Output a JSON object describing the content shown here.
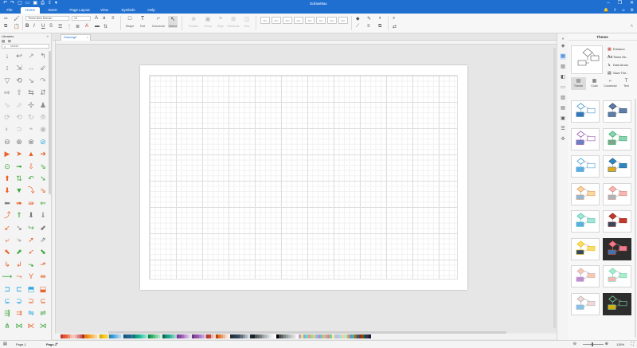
{
  "titlebar": {
    "title": "EdrawMax",
    "quick_access": [
      "undo-icon",
      "redo-icon",
      "new-file-icon",
      "open-icon",
      "save-icon",
      "print-icon",
      "export-icon",
      "more-icon"
    ],
    "window_buttons": [
      "minimize-icon",
      "maximize-icon",
      "close-icon"
    ]
  },
  "menu": {
    "tabs": [
      "File",
      "Home",
      "Insert",
      "Page Layout",
      "View",
      "Symbols",
      "Help"
    ],
    "active": "Home"
  },
  "ribbon": {
    "font_name": "Times New Roman",
    "font_size": "12",
    "tools": [
      {
        "id": "shape",
        "label": "Shape",
        "icon": "□"
      },
      {
        "id": "text",
        "label": "Text",
        "icon": "T"
      },
      {
        "id": "connector",
        "label": "Connector",
        "icon": "⌐"
      },
      {
        "id": "select",
        "label": "Select",
        "icon": "↖"
      }
    ],
    "dim_tools": [
      {
        "id": "position",
        "label": "Position",
        "icon": "⊕"
      },
      {
        "id": "group",
        "label": "Group",
        "icon": "▣"
      },
      {
        "id": "align",
        "label": "Align",
        "icon": "≡"
      },
      {
        "id": "distribute",
        "label": "Distribute",
        "icon": "⊞"
      },
      {
        "id": "size",
        "label": "Size",
        "icon": "◫"
      }
    ],
    "style_boxes": [
      "Abc",
      "Abc",
      "Abc",
      "Abc",
      "Abc",
      "Abc",
      "Abc",
      "Abc"
    ]
  },
  "library": {
    "title": "Libraries",
    "search_placeholder": "search"
  },
  "document": {
    "tab_name": "Drawing3",
    "close_glyph": "×"
  },
  "palette": {
    "colors": [
      "#c0392b",
      "#e74c3c",
      "#e8623c",
      "#f08a5d",
      "#f5b7b1",
      "#f9c9c0",
      "#e6b0aa",
      "#d98880",
      "#cd6155",
      "#a93226",
      "#e67e22",
      "#f39c12",
      "#f5b041",
      "#f8c471",
      "#fad7a0",
      "#fdebd0",
      "#d4ac0d",
      "#f1c40f",
      "#f4d03f",
      "#f7dc6f",
      "#2e86c1",
      "#3498db",
      "#5dade2",
      "#85c1e9",
      "#aed6f1",
      "#d6eaf8",
      "#1a5276",
      "#1f618d",
      "#21618c",
      "#2874a6",
      "#117a65",
      "#16a085",
      "#1abc9c",
      "#48c9b0",
      "#76d7c4",
      "#a3e4d7",
      "#1e8449",
      "#27ae60",
      "#52be80",
      "#7dcea0",
      "#a9dfbf",
      "#d4efdf",
      "#0e6655",
      "#138d75",
      "#17a589",
      "#45b39d",
      "#73c6b6",
      "#a2d9ce",
      "#7d3c98",
      "#8e44ad",
      "#a569bd",
      "#bb8fce",
      "#d2b4de",
      "#e8daef",
      "#6c3483",
      "#884ea0",
      "#9b59b6",
      "#af7ac5",
      "#c39bd3",
      "#d7bde2",
      "#b03a2e",
      "#cb4335",
      "#e6b0aa",
      "#f2d7d5",
      "#ba4a00",
      "#dc7633",
      "#e59866",
      "#edbb99",
      "#f6ddcc",
      "#fbeee6",
      "#212f3d",
      "#283747",
      "#2e4053",
      "#34495e",
      "#5d6d7e",
      "#85929e",
      "#aeb6bf",
      "#d5d8dc",
      "#1b2631",
      "#17202a",
      "#4d5656",
      "#616a6b",
      "#7b7d7d",
      "#95a5a6",
      "#b2babb",
      "#cacfd2",
      "#e5e7e9",
      "#f2f3f4",
      "#ffffff",
      "#000000",
      "#424949",
      "#626567",
      "#7f8c8d",
      "#99a3a4",
      "#b3b6b7",
      "#ccd1d1",
      "#e5e8e8",
      "#f8f9f9",
      "#c39bd3",
      "#f7dc6f",
      "#7fb3d5",
      "#76d7c4",
      "#f1948a",
      "#82e0aa",
      "#f8c471",
      "#85c1e9",
      "#bb8fce",
      "#73c6b6",
      "#f0b27a",
      "#aab7b8",
      "#d98880",
      "#7dcea0",
      "#f9e79f",
      "#a9cce3",
      "#d2b4de",
      "#a3e4d7",
      "#f5cba7",
      "#abebc6",
      "#e59866",
      "#5499c7",
      "#45b39d",
      "#af601a",
      "#1f618d",
      "#922b21",
      "#7e5109",
      "#0b5345",
      "#4a235a",
      "#17202a"
    ]
  },
  "status": {
    "page_selector": "Page-1",
    "page_tab": "Page-1",
    "add_page": "+",
    "zoom": "115%",
    "fit_icon": "fit-page-icon"
  },
  "icon_strip": [
    "fill-icon",
    "theme-icon",
    "image-icon",
    "layers-icon",
    "page-icon",
    "chart-icon",
    "data-icon",
    "history-icon",
    "list-icon",
    "expand-icon"
  ],
  "theme_panel": {
    "title": "Theme",
    "actions": [
      {
        "icon": "▦",
        "label": "Ericsson"
      },
      {
        "icon": "Aa",
        "label": "Times Ne..."
      },
      {
        "icon": "↳",
        "label": "Dark Arrow"
      },
      {
        "icon": "▤",
        "label": "Save The..."
      }
    ],
    "tabs": [
      {
        "id": "theme",
        "label": "Theme",
        "icon": "▤"
      },
      {
        "id": "color",
        "label": "Color",
        "icon": "▦"
      },
      {
        "id": "connector",
        "label": "Connector",
        "icon": "⌐"
      },
      {
        "id": "text",
        "label": "Text",
        "icon": "T"
      }
    ],
    "active_tab": "theme",
    "themes": [
      {
        "accent": "#2e86c1",
        "fill": "#ffffff",
        "box": "#3a76b6",
        "dark": false
      },
      {
        "accent": "#34495e",
        "fill": "#5d7ea8",
        "box": "#5d7ea8",
        "dark": false
      },
      {
        "accent": "#8e44ad",
        "fill": "#ffffff",
        "box": "#6a7fbf",
        "dark": false
      },
      {
        "accent": "#27ae60",
        "fill": "#8fd1b4",
        "box": "#7fa58c",
        "dark": false
      },
      {
        "accent": "#3498db",
        "fill": "#ffffff",
        "box": "#5dade2",
        "dark": false
      },
      {
        "accent": "#1f618d",
        "fill": "#2e86c1",
        "box": "#e6a817",
        "dark": false
      },
      {
        "accent": "#e59866",
        "fill": "#fad7a0",
        "box": "#8fb8d8",
        "dark": false
      },
      {
        "accent": "#d98880",
        "fill": "#f5b7b1",
        "box": "#aab7b8",
        "dark": false
      },
      {
        "accent": "#48c9b0",
        "fill": "#a3e4d7",
        "box": "#5dade2",
        "dark": false
      },
      {
        "accent": "#922b21",
        "fill": "#c0392b",
        "box": "#34495e",
        "dark": false
      },
      {
        "accent": "#f1c40f",
        "fill": "#f7dc6f",
        "box": "#34495e",
        "dark": false
      },
      {
        "accent": "#e74c3c",
        "fill": "#e67e9a",
        "box": "#3a76b6",
        "dark": true
      },
      {
        "accent": "#d2b4de",
        "fill": "#f5cba7",
        "box": "#bb8fce",
        "dark": false
      },
      {
        "accent": "#76d7c4",
        "fill": "#abebc6",
        "box": "#f5b7b1",
        "dark": false
      },
      {
        "accent": "#aab7b8",
        "fill": "#f2d7d5",
        "box": "#85c1e9",
        "dark": false
      },
      {
        "accent": "#82e0aa",
        "fill": "#2d2d2d",
        "box": "#d4ac0d",
        "dark": true
      }
    ]
  },
  "library_shapes": [
    [
      "↓",
      "↩",
      "↗",
      "↰"
    ],
    [
      "↕",
      "⇲",
      "↔",
      "⇙"
    ],
    [
      "▽",
      "⟲",
      "↘",
      "↷"
    ],
    [
      "⇨",
      "⇧",
      "⇆",
      "⇵"
    ],
    [
      "⬂",
      "⬀",
      "✣",
      "♟"
    ],
    [
      "⟳",
      "⟲",
      "↻",
      "⟰"
    ],
    [
      "◐",
      "⊃",
      "◓",
      "◉"
    ],
    [
      "⊖",
      "⊕",
      "⊗",
      "⊘"
    ],
    [
      "▶",
      "➤",
      "▲",
      "➜"
    ],
    [
      "⊙",
      "➟",
      "⇩",
      "⇘"
    ],
    [
      "⬆",
      "⇅",
      "↶",
      "➘"
    ],
    [
      "⬇",
      "▼",
      "⤵",
      "⇘"
    ],
    [
      "⬅",
      "➠",
      "⇛",
      "⇐"
    ],
    [
      "⤴",
      "⇑",
      "⬇",
      "⇓"
    ],
    [
      "↙",
      "↘",
      "↪",
      "⬋"
    ],
    [
      "⤶",
      "⤷",
      "➚",
      "⇗"
    ],
    [
      "⬉",
      "⬈",
      "➶",
      "⬊"
    ],
    [
      "↳",
      "↲",
      "⬎",
      "⬏"
    ],
    [
      "⟿",
      "⤳",
      "Y",
      "⇹"
    ],
    [
      "⊐",
      "⊏",
      "⬒",
      "⬓"
    ],
    [
      "⊊",
      "⊋",
      "⊇",
      "⊆"
    ],
    [
      "⇶",
      "⇉",
      "⇋",
      "⇌"
    ],
    [
      "⋔",
      "⋈",
      "⋉",
      "⋊"
    ]
  ],
  "library_colors": [
    "#808080",
    "#707070",
    "#9e9e9e",
    "#8a8a8a",
    "#8a8a8a",
    "#8a8a8a",
    "#9e9e9e",
    "#8a8a8a",
    "#8a8a8a",
    "#7a7a7a",
    "#8a8a8a",
    "#9e9e9e",
    "#7a7a7a",
    "#8a8a8a",
    "#8a8a8a",
    "#8a8a8a",
    "#bcbcbc",
    "#bcbcbc",
    "#9a9a9a",
    "#8a8a8a",
    "#bcbcbc",
    "#bcbcbc",
    "#bcbcbc",
    "#bcbcbc",
    "#bcbcbc",
    "#bcbcbc",
    "#bcbcbc",
    "#bcbcbc",
    "#7a7a7a",
    "#7a7a7a",
    "#7a7a7a",
    "#2fa7e3",
    "#e8622a",
    "#e8622a",
    "#e8622a",
    "#e8622a",
    "#3fa83c",
    "#3fa83c",
    "#e8622a",
    "#3fa83c",
    "#e8622a",
    "#3fa83c",
    "#3fa83c",
    "#3fa83c",
    "#e8622a",
    "#3fa83c",
    "#e8622a",
    "#e8622a",
    "#7a7a7a",
    "#e8622a",
    "#e8622a",
    "#3fa83c",
    "#e8622a",
    "#3fa83c",
    "#7a7a7a",
    "#7a7a7a",
    "#e8622a",
    "#7a7a7a",
    "#3fa83c",
    "#7a7a7a",
    "#e8622a",
    "#7a7a7a",
    "#e8622a",
    "#7a7a7a",
    "#e8622a",
    "#3fa83c",
    "#e8622a",
    "#3fa83c",
    "#e8622a",
    "#e8622a",
    "#3fa83c",
    "#e8622a",
    "#3fa83c",
    "#e8622a",
    "#e8622a",
    "#e8622a",
    "#2fa7e3",
    "#2fa7e3",
    "#2fa7e3",
    "#e8622a",
    "#2fa7e3",
    "#2fa7e3",
    "#e8622a",
    "#e8622a",
    "#3fa83c",
    "#e8622a",
    "#2fa7e3",
    "#3fa83c",
    "#3fa83c",
    "#3fa83c",
    "#e8622a",
    "#3fa83c"
  ]
}
